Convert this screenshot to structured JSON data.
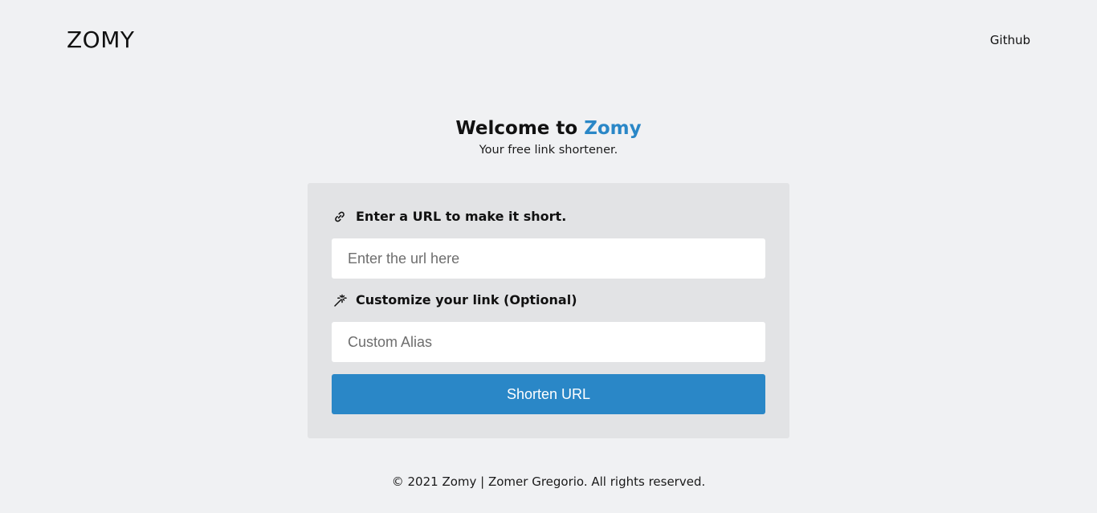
{
  "header": {
    "logo": "ZOMY",
    "nav_github": "Github"
  },
  "hero": {
    "title_prefix": "Welcome to ",
    "title_accent": "Zomy",
    "subtitle": "Your free link shortener."
  },
  "form": {
    "url_label": "Enter a URL to make it short.",
    "url_label_icon": "link-icon",
    "url_placeholder": "Enter the url here",
    "url_value": "",
    "alias_label": "Customize your link (Optional)",
    "alias_label_icon": "magic-wand-icon",
    "alias_placeholder": "Custom Alias",
    "alias_value": "",
    "submit_label": "Shorten URL"
  },
  "footer": {
    "copyright": "© 2021 Zomy | Zomer Gregorio. All rights reserved."
  },
  "colors": {
    "accent": "#2a87c7",
    "background": "#f0f1f3",
    "card": "#e2e3e5"
  }
}
